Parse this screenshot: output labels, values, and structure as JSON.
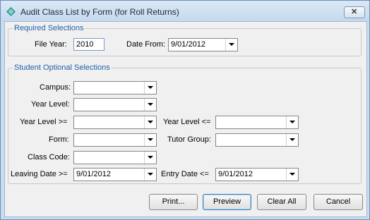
{
  "window": {
    "title": "Audit Class List by Form (for Roll Returns)",
    "close_glyph": "✕"
  },
  "required": {
    "legend": "Required Selections",
    "file_year_label": "File Year:",
    "file_year_value": "2010",
    "date_from_label": "Date From:",
    "date_from_value": "9/01/2012"
  },
  "optional": {
    "legend": "Student Optional Selections",
    "campus_label": "Campus:",
    "campus_value": "",
    "year_level_label": "Year Level:",
    "year_level_value": "",
    "year_level_gte_label": "Year Level >=",
    "year_level_gte_value": "",
    "year_level_lte_label": "Year Level <=",
    "year_level_lte_value": "",
    "form_label": "Form:",
    "form_value": "",
    "tutor_group_label": "Tutor Group:",
    "tutor_group_value": "",
    "class_code_label": "Class Code:",
    "class_code_value": "",
    "leaving_date_label": "Leaving Date >=",
    "leaving_date_value": "9/01/2012",
    "entry_date_label": "Entry Date <=",
    "entry_date_value": "9/01/2012"
  },
  "buttons": {
    "print": "Print...",
    "preview": "Preview",
    "clear_all": "Clear All",
    "cancel": "Cancel"
  }
}
